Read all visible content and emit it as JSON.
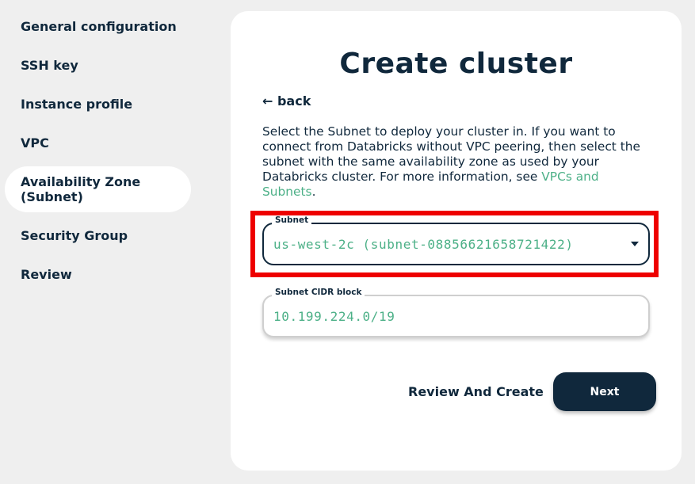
{
  "sidebar": {
    "items": [
      {
        "label": "General configuration"
      },
      {
        "label": "SSH key"
      },
      {
        "label": "Instance profile"
      },
      {
        "label": "VPC"
      },
      {
        "label": "Availability Zone (Subnet)",
        "active": true
      },
      {
        "label": "Security Group"
      },
      {
        "label": "Review"
      }
    ]
  },
  "main": {
    "title": "Create cluster",
    "back_label": "← back",
    "description": "Select the Subnet to deploy your cluster in. If you want to connect from Databricks without VPC peering, then select the subnet with the same availability zone as used by your Databricks cluster. For more information, see ",
    "description_link": "VPCs and Subnets",
    "description_end": ".",
    "subnet": {
      "label": "Subnet",
      "value": "us-west-2c (subnet-08856621658721422)"
    },
    "cidr": {
      "label": "Subnet CIDR block",
      "value": "10.199.224.0/19"
    },
    "review_label": "Review And Create",
    "next_label": "Next"
  },
  "colors": {
    "brand_dark": "#10283c",
    "accent_green": "#4cb087",
    "highlight_red": "#ee0000",
    "background": "#efefef"
  },
  "icons": {
    "back": "arrow-left-icon",
    "dropdown": "caret-down-icon"
  }
}
